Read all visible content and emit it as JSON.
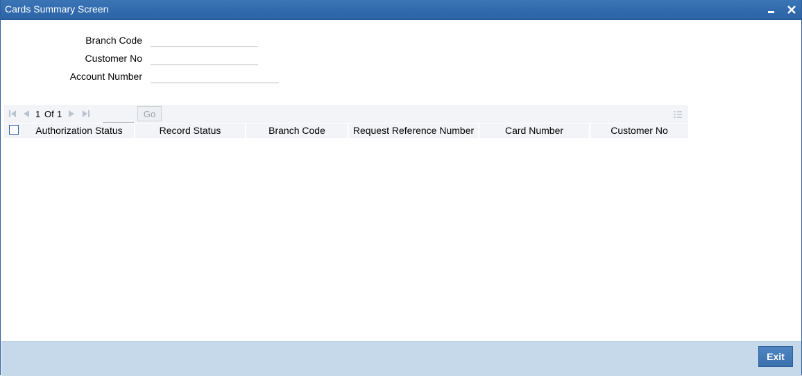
{
  "window": {
    "title": "Cards Summary Screen",
    "minimize_icon": "minimize-icon",
    "close_icon": "close-icon"
  },
  "form": {
    "branch_code_label": "Branch Code",
    "branch_code_value": "",
    "customer_no_label": "Customer No",
    "customer_no_value": "",
    "account_number_label": "Account Number",
    "account_number_value": ""
  },
  "pager": {
    "current": "1",
    "of_label": "Of",
    "total": "1",
    "go_label": "Go",
    "page_input_value": "",
    "icons": [
      "first-page-icon",
      "previous-page-icon",
      "next-page-icon",
      "last-page-icon",
      "columns-icon"
    ]
  },
  "table": {
    "columns": [
      "Authorization Status",
      "Record Status",
      "Branch Code",
      "Request Reference Number",
      "Card Number",
      "Customer No"
    ],
    "rows": []
  },
  "footer": {
    "exit_label": "Exit"
  },
  "colors": {
    "titlebar": "#2b63a6",
    "footer": "#c6d9ea",
    "exit_button": "#3a70ad"
  }
}
